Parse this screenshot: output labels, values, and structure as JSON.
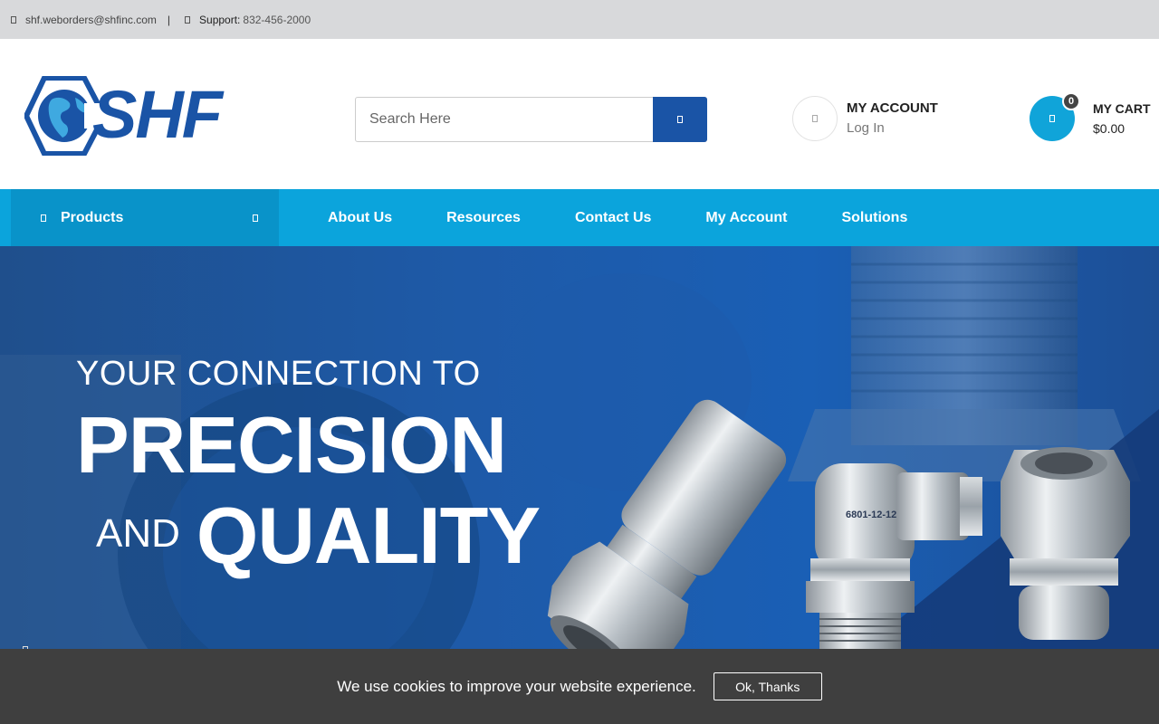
{
  "topbar": {
    "email": "shf.weborders@shfinc.com",
    "separator": "|",
    "support_label": "Support:",
    "support_phone": "832-456-2000"
  },
  "header": {
    "logo_text": "SHF",
    "search_placeholder": "Search Here",
    "account_title": "MY ACCOUNT",
    "account_link": "Log In",
    "cart_title": "MY CART",
    "cart_total": "$0.00",
    "cart_count": "0"
  },
  "nav": {
    "products_label": "Products",
    "items": [
      "About Us",
      "Resources",
      "Contact Us",
      "My Account",
      "Solutions"
    ]
  },
  "hero": {
    "line1": "YOUR CONNECTION TO",
    "line2": "PRECISION",
    "line3_and": "AND",
    "line3_quality": "QUALITY",
    "fitting_marking": "6801-12-12"
  },
  "cookie": {
    "message": "We use cookies to improve your website experience.",
    "button": "Ok, Thanks"
  },
  "colors": {
    "brand_blue": "#1a54a6",
    "nav_cyan": "#0ba4dc",
    "products_bg": "#0993c9",
    "cookie_bg": "#3f3f3f"
  },
  "icons": {
    "email": "envelope-icon",
    "phone": "phone-icon",
    "search": "search-icon",
    "account": "user-icon",
    "cart": "cart-icon",
    "menu": "menu-icon",
    "caret": "chevron-down-icon"
  }
}
